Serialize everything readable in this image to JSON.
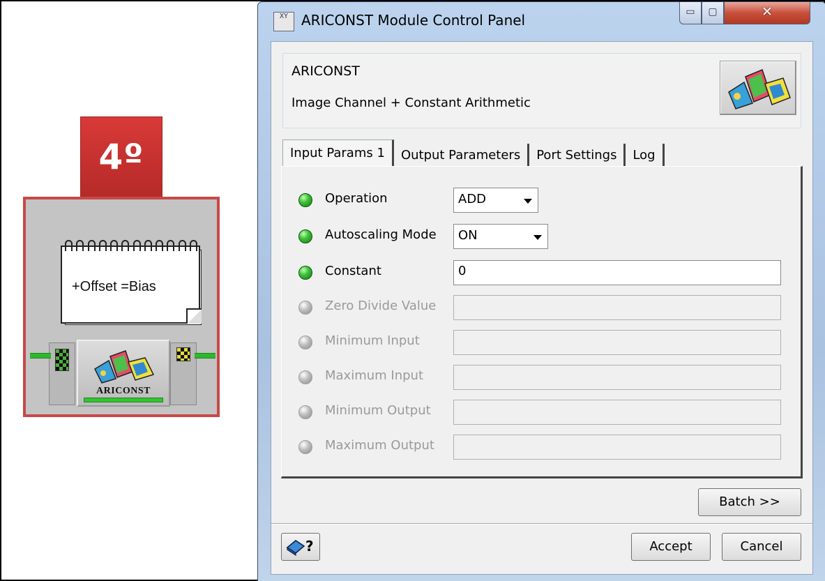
{
  "node": {
    "step_badge": "4º",
    "note_text": "+Offset =Bias",
    "module_label": "ARICONST"
  },
  "window": {
    "title": "ARICONST Module Control Panel",
    "title_icon": "XY",
    "controls": {
      "minimize": "▭",
      "maximize": "▢",
      "close": "✕"
    }
  },
  "module": {
    "name": "ARICONST",
    "description": "Image Channel + Constant Arithmetic"
  },
  "tabs": [
    {
      "label": "Input Params 1",
      "active": true
    },
    {
      "label": "Output Parameters",
      "active": false
    },
    {
      "label": "Port Settings",
      "active": false
    },
    {
      "label": "Log",
      "active": false
    }
  ],
  "params": {
    "operation": {
      "label": "Operation",
      "value": "ADD"
    },
    "autoscaling": {
      "label": "Autoscaling Mode",
      "value": "ON"
    },
    "constant": {
      "label": "Constant",
      "value": "0"
    },
    "zero_divide": {
      "label": "Zero Divide Value",
      "value": ""
    },
    "min_input": {
      "label": "Minimum Input",
      "value": ""
    },
    "max_input": {
      "label": "Maximum Input",
      "value": ""
    },
    "min_output": {
      "label": "Minimum Output",
      "value": ""
    },
    "max_output": {
      "label": "Maximum Output",
      "value": ""
    }
  },
  "buttons": {
    "batch": "Batch >>",
    "accept": "Accept",
    "cancel": "Cancel",
    "help": "?"
  },
  "colors": {
    "badge_red": "#c8302e",
    "led_on": "#3ec23a",
    "led_off": "#bdbdbd",
    "window_chrome": "#a9c2e0",
    "close_button": "#c8503c"
  },
  "icons": {
    "led_on": "green-led-icon",
    "led_off": "gray-led-icon",
    "module": "ariconst-module-icon",
    "help": "help-book-icon"
  }
}
